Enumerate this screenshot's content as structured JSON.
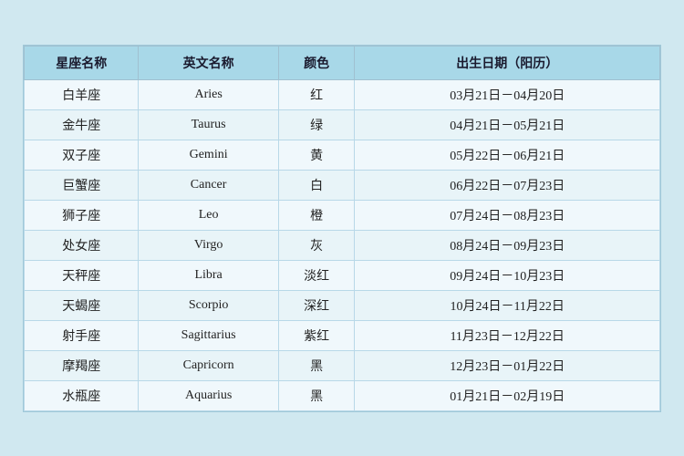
{
  "table": {
    "headers": [
      "星座名称",
      "英文名称",
      "颜色",
      "出生日期（阳历）"
    ],
    "rows": [
      {
        "cn": "白羊座",
        "en": "Aries",
        "color": "红",
        "date": "03月21日－04月20日"
      },
      {
        "cn": "金牛座",
        "en": "Taurus",
        "color": "绿",
        "date": "04月21日－05月21日"
      },
      {
        "cn": "双子座",
        "en": "Gemini",
        "color": "黄",
        "date": "05月22日－06月21日"
      },
      {
        "cn": "巨蟹座",
        "en": "Cancer",
        "color": "白",
        "date": "06月22日－07月23日"
      },
      {
        "cn": "狮子座",
        "en": "Leo",
        "color": "橙",
        "date": "07月24日－08月23日"
      },
      {
        "cn": "处女座",
        "en": "Virgo",
        "color": "灰",
        "date": "08月24日－09月23日"
      },
      {
        "cn": "天秤座",
        "en": "Libra",
        "color": "淡红",
        "date": "09月24日－10月23日"
      },
      {
        "cn": "天蝎座",
        "en": "Scorpio",
        "color": "深红",
        "date": "10月24日－11月22日"
      },
      {
        "cn": "射手座",
        "en": "Sagittarius",
        "color": "紫红",
        "date": "11月23日－12月22日"
      },
      {
        "cn": "摩羯座",
        "en": "Capricorn",
        "color": "黑",
        "date": "12月23日－01月22日"
      },
      {
        "cn": "水瓶座",
        "en": "Aquarius",
        "color": "黑",
        "date": "01月21日－02月19日"
      }
    ]
  }
}
